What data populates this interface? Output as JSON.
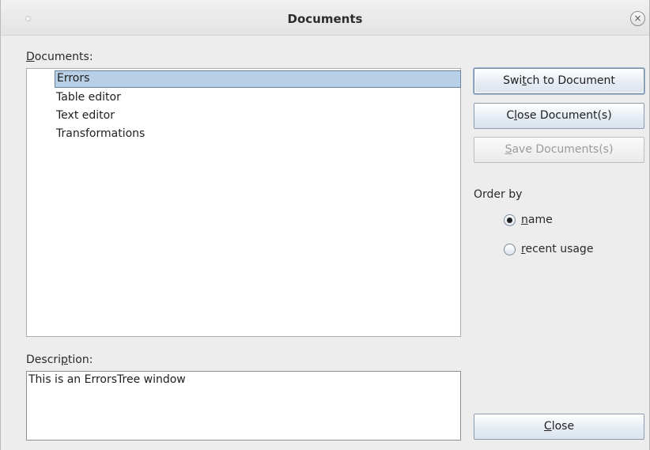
{
  "window": {
    "title": "Documents",
    "close_glyph": "×"
  },
  "documents": {
    "label_mnemonic": "D",
    "label_rest": "ocuments:",
    "items": [
      {
        "label": "Errors",
        "selected": true
      },
      {
        "label": "Table editor",
        "selected": false
      },
      {
        "label": "Text editor",
        "selected": false
      },
      {
        "label": "Transformations",
        "selected": false
      }
    ]
  },
  "description": {
    "label_pre": "Descri",
    "label_mnemonic": "p",
    "label_post": "tion:",
    "text": "This is an ErrorsTree window"
  },
  "buttons": {
    "switch": {
      "pre": "Swi",
      "mnemonic": "t",
      "post": "ch to Document"
    },
    "close_docs": {
      "pre": "C",
      "mnemonic": "l",
      "post": "ose Document(s)"
    },
    "save_docs": {
      "pre": "",
      "mnemonic": "S",
      "post": "ave Documents(s)",
      "enabled": false
    },
    "close": {
      "pre": "",
      "mnemonic": "C",
      "post": "lose"
    }
  },
  "order_by": {
    "label": "Order by",
    "options": [
      {
        "mnemonic": "n",
        "rest": "ame",
        "checked": true
      },
      {
        "mnemonic": "r",
        "rest": "ecent usage",
        "checked": false
      }
    ]
  },
  "icons": {
    "window_menu": "window-menu-dot-icon",
    "close": "close-icon"
  }
}
